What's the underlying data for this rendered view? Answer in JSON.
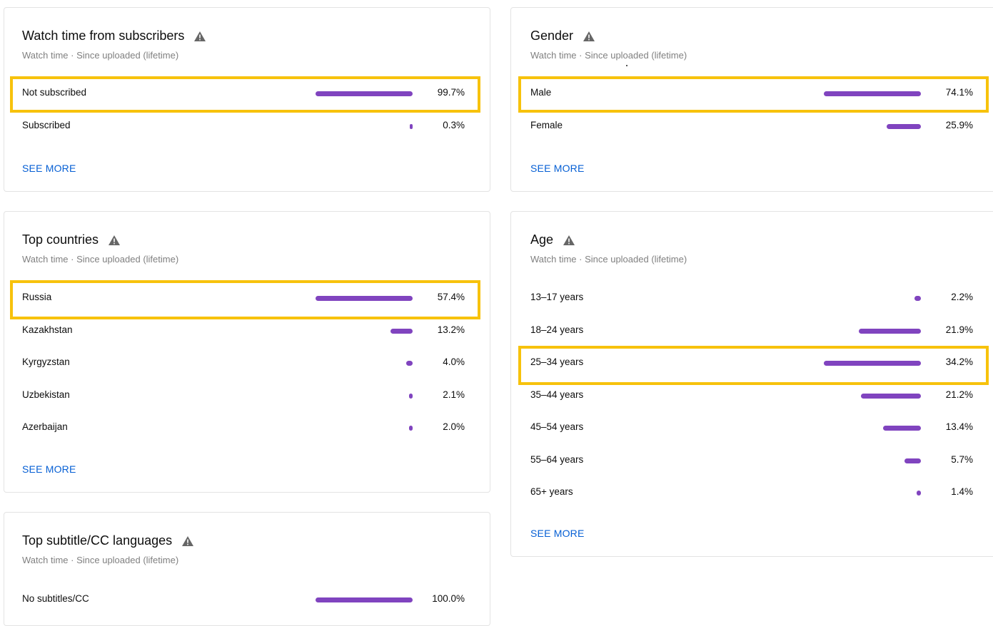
{
  "subscribers": {
    "title": "Watch time from subscribers",
    "subtitle": "Watch time · Since uploaded (lifetime)",
    "rows": [
      {
        "label": "Not subscribed",
        "value": "99.7%",
        "pct": 99.7
      },
      {
        "label": "Subscribed",
        "value": "0.3%",
        "pct": 0.3
      }
    ],
    "see_more": "SEE MORE"
  },
  "gender": {
    "title": "Gender",
    "subtitle": "Watch time · Since uploaded (lifetime)",
    "rows": [
      {
        "label": "Male",
        "value": "74.1%",
        "pct": 74.1
      },
      {
        "label": "Female",
        "value": "25.9%",
        "pct": 25.9
      }
    ],
    "see_more": "SEE MORE"
  },
  "countries": {
    "title": "Top countries",
    "subtitle": "Watch time · Since uploaded (lifetime)",
    "rows": [
      {
        "label": "Russia",
        "value": "57.4%",
        "pct": 57.4
      },
      {
        "label": "Kazakhstan",
        "value": "13.2%",
        "pct": 13.2
      },
      {
        "label": "Kyrgyzstan",
        "value": "4.0%",
        "pct": 4.0
      },
      {
        "label": "Uzbekistan",
        "value": "2.1%",
        "pct": 2.1
      },
      {
        "label": "Azerbaijan",
        "value": "2.0%",
        "pct": 2.0
      }
    ],
    "see_more": "SEE MORE"
  },
  "age": {
    "title": "Age",
    "subtitle": "Watch time · Since uploaded (lifetime)",
    "rows": [
      {
        "label": "13–17 years",
        "value": "2.2%",
        "pct": 2.2
      },
      {
        "label": "18–24 years",
        "value": "21.9%",
        "pct": 21.9
      },
      {
        "label": "25–34 years",
        "value": "34.2%",
        "pct": 34.2
      },
      {
        "label": "35–44 years",
        "value": "21.2%",
        "pct": 21.2
      },
      {
        "label": "45–54 years",
        "value": "13.4%",
        "pct": 13.4
      },
      {
        "label": "55–64 years",
        "value": "5.7%",
        "pct": 5.7
      },
      {
        "label": "65+ years",
        "value": "1.4%",
        "pct": 1.4
      }
    ],
    "see_more": "SEE MORE"
  },
  "subtitles": {
    "title": "Top subtitle/CC languages",
    "subtitle": "Watch time · Since uploaded (lifetime)",
    "rows": [
      {
        "label": "No subtitles/CC",
        "value": "100.0%",
        "pct": 100.0
      }
    ]
  },
  "colors": {
    "bar": "#8044bf",
    "highlight": "#f7c20c",
    "link": "#065fd4",
    "warning_icon": "#666666"
  },
  "icons": {
    "warning": "warning-triangle-icon"
  }
}
